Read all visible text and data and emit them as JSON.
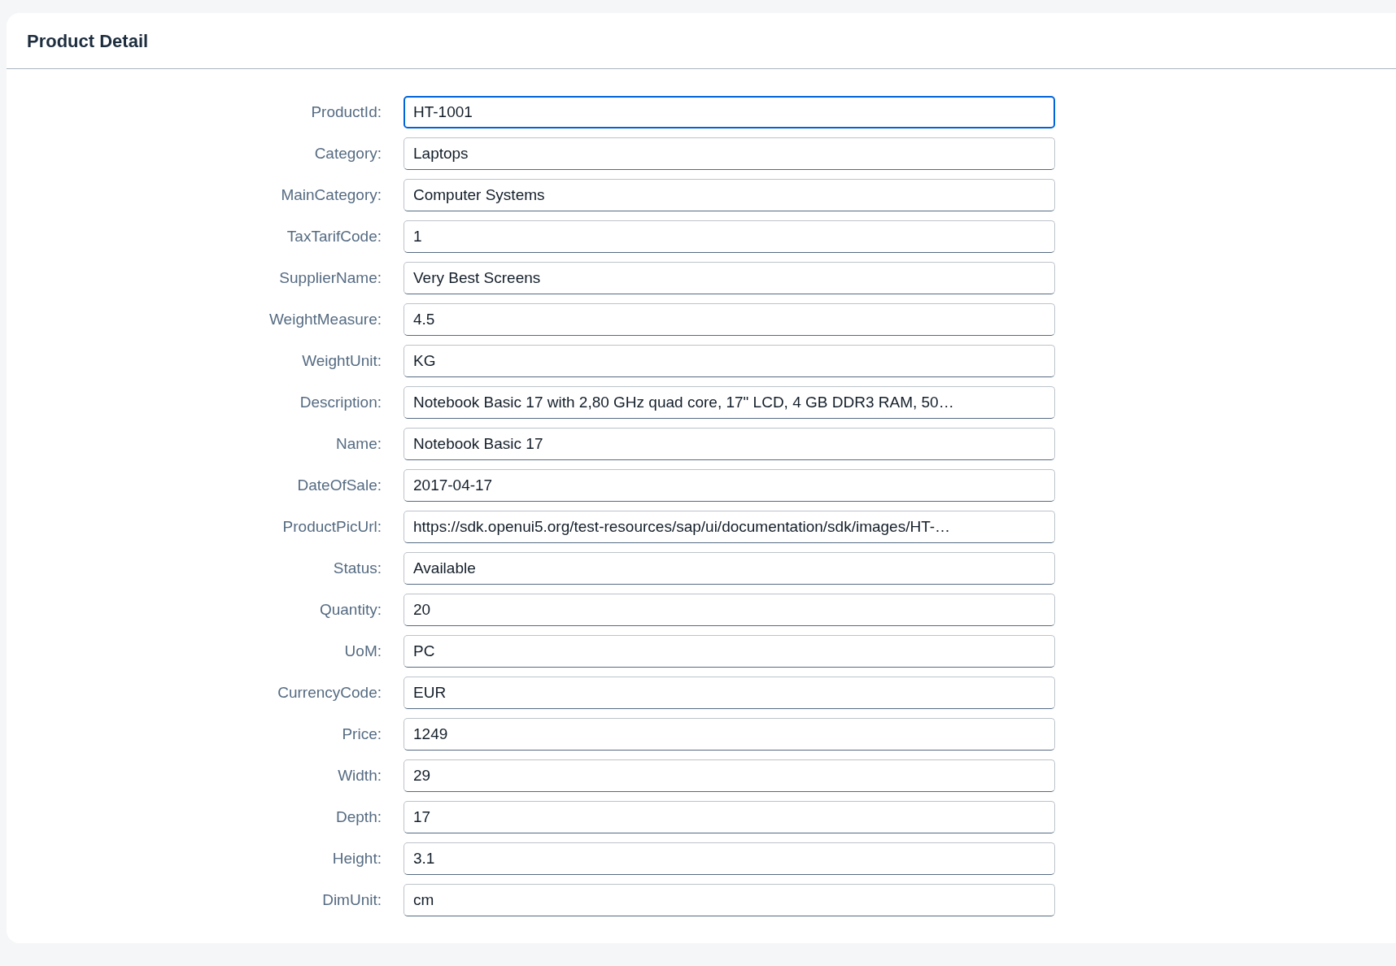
{
  "panel": {
    "title": "Product Detail"
  },
  "fields": [
    {
      "label": "ProductId:",
      "value": "HT-1001",
      "focused": true
    },
    {
      "label": "Category:",
      "value": "Laptops",
      "focused": false
    },
    {
      "label": "MainCategory:",
      "value": "Computer Systems",
      "focused": false
    },
    {
      "label": "TaxTarifCode:",
      "value": "1",
      "focused": false
    },
    {
      "label": "SupplierName:",
      "value": "Very Best Screens",
      "focused": false
    },
    {
      "label": "WeightMeasure:",
      "value": "4.5",
      "focused": false
    },
    {
      "label": "WeightUnit:",
      "value": "KG",
      "focused": false
    },
    {
      "label": "Description:",
      "value": "Notebook Basic 17 with 2,80 GHz quad core, 17\" LCD, 4 GB DDR3 RAM, 50…",
      "focused": false
    },
    {
      "label": "Name:",
      "value": "Notebook Basic 17",
      "focused": false
    },
    {
      "label": "DateOfSale:",
      "value": "2017-04-17",
      "focused": false
    },
    {
      "label": "ProductPicUrl:",
      "value": "https://sdk.openui5.org/test-resources/sap/ui/documentation/sdk/images/HT-…",
      "focused": false
    },
    {
      "label": "Status:",
      "value": "Available",
      "focused": false
    },
    {
      "label": "Quantity:",
      "value": "20",
      "focused": false
    },
    {
      "label": "UoM:",
      "value": "PC",
      "focused": false
    },
    {
      "label": "CurrencyCode:",
      "value": "EUR",
      "focused": false
    },
    {
      "label": "Price:",
      "value": "1249",
      "focused": false
    },
    {
      "label": "Width:",
      "value": "29",
      "focused": false
    },
    {
      "label": "Depth:",
      "value": "17",
      "focused": false
    },
    {
      "label": "Height:",
      "value": "3.1",
      "focused": false
    },
    {
      "label": "DimUnit:",
      "value": "cm",
      "focused": false
    }
  ]
}
